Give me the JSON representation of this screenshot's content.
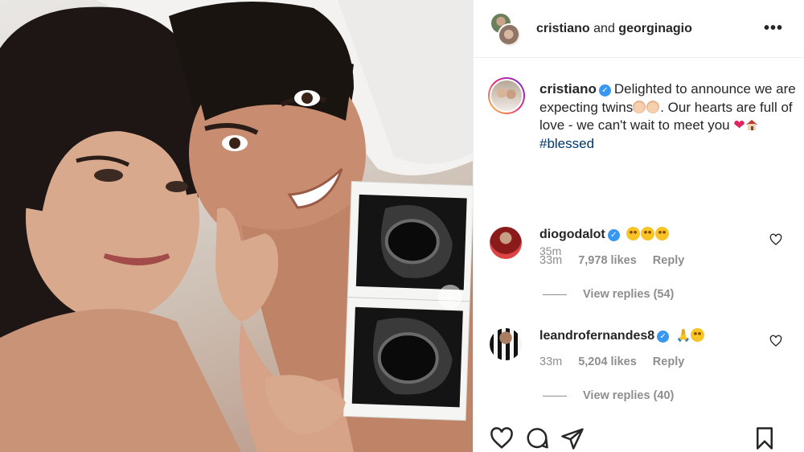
{
  "header": {
    "user1": "cristiano",
    "and_text": "and",
    "user2": "georginagio",
    "more_label": "•••"
  },
  "caption": {
    "username": "cristiano",
    "text_part1": "Delighted to announce we are expecting twins",
    "text_part2": ". Our hearts are full of love - we can't wait to meet you",
    "hashtag": "#blessed",
    "time": "35m"
  },
  "comments": [
    {
      "username": "diogodalot",
      "time": "33m",
      "likes": "7,978 likes",
      "reply_label": "Reply",
      "view_replies": "View replies (54)"
    },
    {
      "username": "leandrofernandes8",
      "time": "33m",
      "likes": "5,204 likes",
      "reply_label": "Reply",
      "view_replies": "View replies (40)"
    }
  ],
  "icons": {
    "like": "heart-icon",
    "comment": "comment-icon",
    "share": "share-icon",
    "save": "bookmark-icon",
    "next": "chevron-right-icon"
  },
  "colors": {
    "verified": "#3897f0",
    "muted": "#8e8e8e",
    "hashtag": "#00376b",
    "text": "#262626"
  },
  "carousel_next": "›"
}
